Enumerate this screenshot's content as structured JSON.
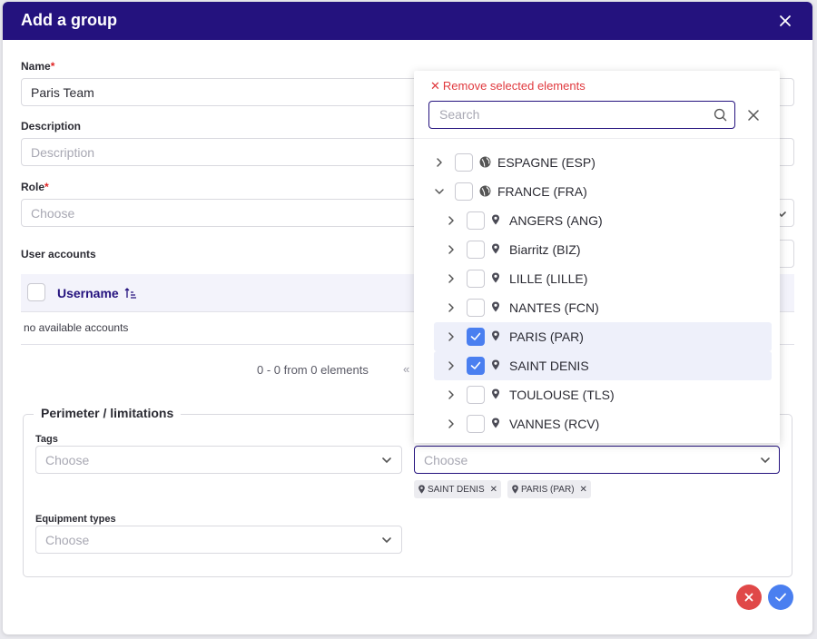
{
  "modal": {
    "title": "Add a group",
    "name_label": "Name",
    "name_value": "Paris Team",
    "description_label": "Description",
    "description_placeholder": "Description",
    "role_label": "Role",
    "role_placeholder": "Choose",
    "user_accounts_label": "User accounts",
    "required_mark": "*"
  },
  "table": {
    "column_username": "Username",
    "empty_text": "no available accounts",
    "pager_text": "0 - 0 from 0 elements",
    "pager_nav": "«"
  },
  "perimeter": {
    "legend": "Perimeter / limitations",
    "tags_label": "Tags",
    "tags_placeholder": "Choose",
    "sites_placeholder": "Choose",
    "equipment_label": "Equipment types",
    "equipment_placeholder": "Choose",
    "chips": [
      {
        "label": "SAINT DENIS"
      },
      {
        "label": "PARIS (PAR)"
      }
    ]
  },
  "dropdown": {
    "remove_selected": "Remove selected elements",
    "search_placeholder": "Search",
    "nodes": [
      {
        "label": "ESPAGNE (ESP)",
        "icon": "globe-icon",
        "level": 0,
        "expanded": false,
        "checked": false
      },
      {
        "label": "FRANCE (FRA)",
        "icon": "globe-icon",
        "level": 0,
        "expanded": true,
        "checked": false
      },
      {
        "label": "ANGERS (ANG)",
        "icon": "map-pin-icon",
        "level": 1,
        "expanded": false,
        "checked": false
      },
      {
        "label": "Biarritz (BIZ)",
        "icon": "map-pin-icon",
        "level": 1,
        "expanded": false,
        "checked": false
      },
      {
        "label": "LILLE (LILLE)",
        "icon": "map-pin-icon",
        "level": 1,
        "expanded": false,
        "checked": false
      },
      {
        "label": "NANTES (FCN)",
        "icon": "map-pin-icon",
        "level": 1,
        "expanded": false,
        "checked": false
      },
      {
        "label": "PARIS (PAR)",
        "icon": "map-pin-icon",
        "level": 1,
        "expanded": false,
        "checked": true
      },
      {
        "label": "SAINT DENIS",
        "icon": "map-pin-icon",
        "level": 1,
        "expanded": false,
        "checked": true
      },
      {
        "label": "TOULOUSE (TLS)",
        "icon": "map-pin-icon",
        "level": 1,
        "expanded": false,
        "checked": false
      },
      {
        "label": "VANNES (RCV)",
        "icon": "map-pin-icon",
        "level": 1,
        "expanded": false,
        "checked": false
      }
    ]
  },
  "colors": {
    "header": "#24127e",
    "accent": "#4a7ff0",
    "danger": "#e04848"
  }
}
